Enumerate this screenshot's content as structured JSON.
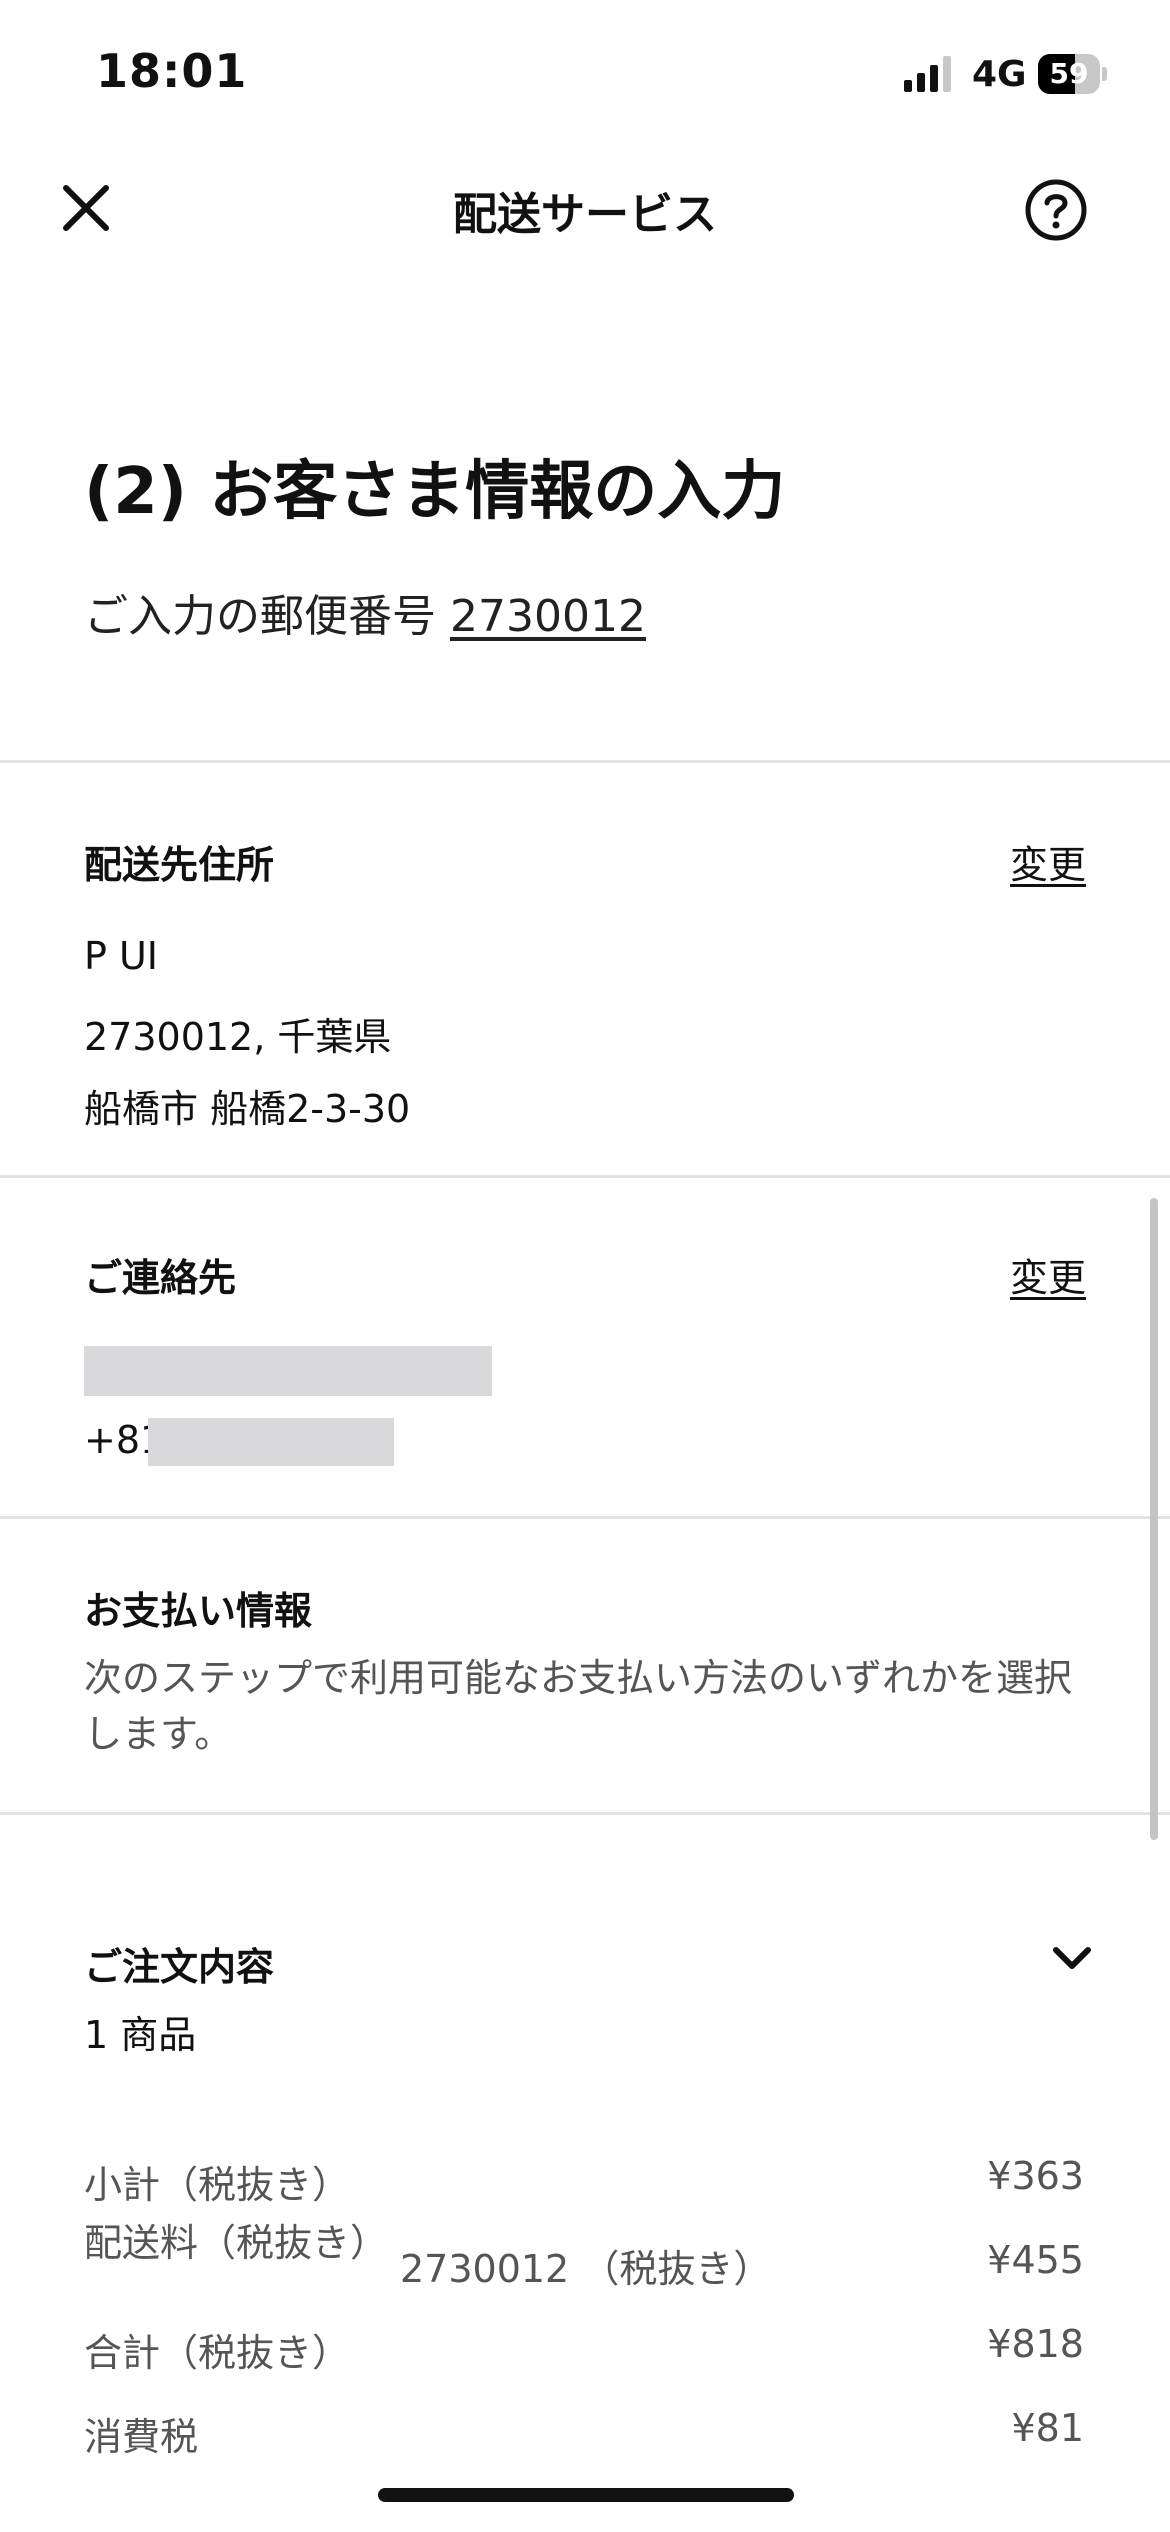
{
  "status_bar": {
    "time": "18:01",
    "network": "4G",
    "battery": "59",
    "battery_level": 0.59
  },
  "header": {
    "title": "配送サービス",
    "close_icon": "close-icon",
    "help_icon": "help-circle-icon"
  },
  "intro": {
    "step_title": "(2) お客さま情報の入力",
    "postal_prefix": "ご入力の郵便番号",
    "postal_code": "2730012"
  },
  "shipping_address": {
    "title": "配送先住所",
    "change_label": "変更",
    "lines": [
      "P UI",
      "2730012, 千葉県",
      "船橋市 船橋2-3-30"
    ]
  },
  "contact": {
    "title": "ご連絡先",
    "change_label": "変更",
    "phone_prefix": "+81"
  },
  "payment": {
    "title": "お支払い情報",
    "description": "次のステップで利用可能なお支払い方法のいずれかを選択します。"
  },
  "order": {
    "title": "ご注文内容",
    "item_count": "1 商品",
    "rows": [
      {
        "label": "小計（税抜き）",
        "value": "¥363"
      },
      {
        "label": "配送料（税抜き）",
        "sub": "2730012 （税抜き）",
        "value": "¥455"
      },
      {
        "label": "合計（税抜き）",
        "value": "¥818"
      },
      {
        "label": "消費税",
        "value": "¥81"
      }
    ]
  },
  "colors": {
    "text": "#111111",
    "muted": "#555555",
    "divider": "#e4e4e4",
    "redaction": "#d9d9db"
  }
}
